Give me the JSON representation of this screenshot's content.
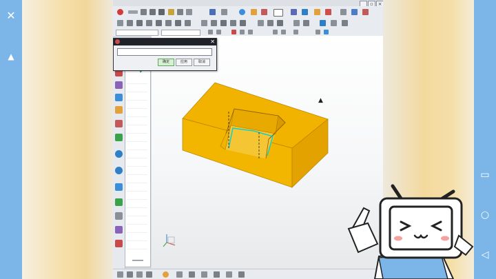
{
  "app": {
    "window_buttons": [
      "_",
      "▫",
      "×"
    ]
  },
  "dialog": {
    "input_value": "",
    "buttons": [
      {
        "label": "确定"
      },
      {
        "label": "应用"
      },
      {
        "label": "取消"
      }
    ]
  },
  "overlay": {
    "left_buttons": [
      {
        "icon": "✕"
      },
      {
        "icon": "▲"
      }
    ],
    "right_buttons": [
      {
        "icon": "▭"
      },
      {
        "icon": "○"
      },
      {
        "icon": "◁"
      }
    ]
  },
  "colors": {
    "part": "#f2b200",
    "part_side": "#e3a200",
    "selection_edge": "#00d2d0",
    "overlay_bar": "#7cb6e8"
  }
}
